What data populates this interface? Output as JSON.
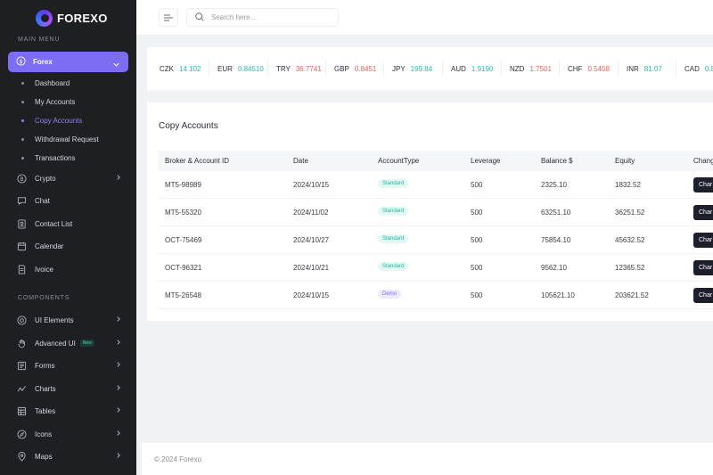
{
  "brand": {
    "name": "FOREXO"
  },
  "sidebar": {
    "main_menu_label": "MAIN MENU",
    "components_label": "COMPONENTS",
    "active": {
      "label": "Forex"
    },
    "forex_subitems": [
      {
        "label": "Dashboard"
      },
      {
        "label": "My Accounts"
      },
      {
        "label": "Copy Accounts"
      },
      {
        "label": "Withdrawal Request"
      },
      {
        "label": "Transactions"
      }
    ],
    "main_items": [
      {
        "label": "Crypto",
        "icon": "bitcoin-icon",
        "has_chevron": true
      },
      {
        "label": "Chat",
        "icon": "chat-icon",
        "has_chevron": false
      },
      {
        "label": "Contact List",
        "icon": "contact-icon",
        "has_chevron": false
      },
      {
        "label": "Calendar",
        "icon": "calendar-icon",
        "has_chevron": false
      },
      {
        "label": "Ivoice",
        "icon": "invoice-icon",
        "has_chevron": false
      }
    ],
    "component_items": [
      {
        "label": "UI Elements",
        "icon": "layers-icon",
        "has_chevron": true
      },
      {
        "label": "Advanced UI",
        "icon": "hand-icon",
        "has_chevron": true,
        "badge": "New"
      },
      {
        "label": "Forms",
        "icon": "forms-icon",
        "has_chevron": true
      },
      {
        "label": "Charts",
        "icon": "chart-icon",
        "has_chevron": true
      },
      {
        "label": "Tables",
        "icon": "table-icon",
        "has_chevron": true
      },
      {
        "label": "Icons",
        "icon": "compass-icon",
        "has_chevron": true
      },
      {
        "label": "Maps",
        "icon": "map-pin-icon",
        "has_chevron": true
      }
    ]
  },
  "header": {
    "search_placeholder": "Search here..."
  },
  "ticker": [
    {
      "code": "CZK",
      "value": "14.102",
      "trend": "up"
    },
    {
      "code": "EUR",
      "value": "0.84510",
      "trend": "up"
    },
    {
      "code": "TRY",
      "value": "36.7741",
      "trend": "down"
    },
    {
      "code": "GBP",
      "value": "0.8451",
      "trend": "down"
    },
    {
      "code": "JPY",
      "value": "199.84",
      "trend": "up"
    },
    {
      "code": "AUD",
      "value": "1.9190",
      "trend": "up"
    },
    {
      "code": "NZD",
      "value": "1.7501",
      "trend": "down"
    },
    {
      "code": "CHF",
      "value": "0.5458",
      "trend": "down"
    },
    {
      "code": "INR",
      "value": "81.07",
      "trend": "up"
    },
    {
      "code": "CAD",
      "value": "0.8",
      "trend": "up"
    }
  ],
  "copy_accounts": {
    "title": "Copy Accounts",
    "columns": [
      "Broker & Account ID",
      "Date",
      "AccountType",
      "Leverage",
      "Balance $",
      "Equity",
      "Chang"
    ],
    "rows": [
      {
        "id": "MT5-98989",
        "date": "2024/10/15",
        "type": "Standard",
        "leverage": "500",
        "balance": "2325.10",
        "equity": "1832.52",
        "action": "Char"
      },
      {
        "id": "MT5-55320",
        "date": "2024/11/02",
        "type": "Standard",
        "leverage": "500",
        "balance": "63251.10",
        "equity": "36251.52",
        "action": "Char"
      },
      {
        "id": "OCT-75469",
        "date": "2024/10/27",
        "type": "Standard",
        "leverage": "500",
        "balance": "75854.10",
        "equity": "45632.52",
        "action": "Char"
      },
      {
        "id": "OCT-96321",
        "date": "2024/10/21",
        "type": "Standard",
        "leverage": "500",
        "balance": "9562.10",
        "equity": "12365.52",
        "action": "Char"
      },
      {
        "id": "MT5-26548",
        "date": "2024/10/15",
        "type": "Demo",
        "leverage": "500",
        "balance": "105621.10",
        "equity": "203621.52",
        "action": "Char"
      }
    ]
  },
  "footer": {
    "text": "© 2024 Forexo"
  },
  "colors": {
    "accent": "#7c6df2",
    "up": "#1fc0a9",
    "down": "#ec5b5b",
    "sidebar_bg": "#1d1f23"
  }
}
